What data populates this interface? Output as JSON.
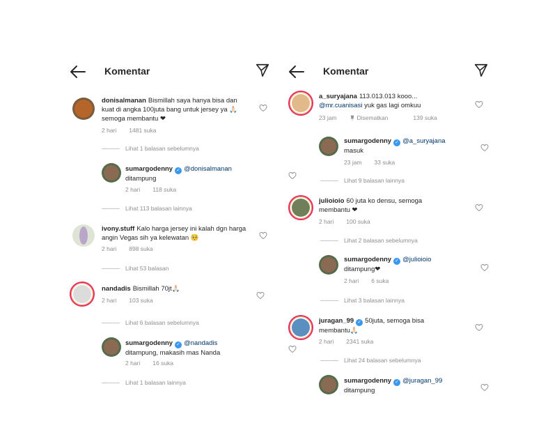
{
  "left": {
    "header": {
      "title": "Komentar"
    },
    "comments": [
      {
        "user": "donisalmanan",
        "text": "Bismillah saya hanya bisa dan kuat di angka 100juta bang untuk jersey ya 🙏🏻 semoga membantu ❤",
        "time": "2 hari",
        "likes": "1481 suka"
      },
      {
        "replies_link": "Lihat 1 balasan sebelumnya"
      },
      {
        "user": "sumargodenny",
        "mention": "@donisalmanan",
        "text": "ditampung",
        "time": "2 hari",
        "likes": "118 suka"
      },
      {
        "replies_link": "Lihat 113 balasan lainnya"
      },
      {
        "user": "ivony.stuff",
        "text": "Kalo harga jersey ini kalah dgn harga angin Vegas sih ya kelewatan 🥺",
        "time": "2 hari",
        "likes": "898 suka"
      },
      {
        "replies_link": "Lihat 53 balasan"
      },
      {
        "user": "nandadis",
        "text": "Bismillah 70jt🙏🏻",
        "time": "2 hari",
        "likes": "103 suka"
      },
      {
        "replies_link": "Lihat 6 balasan sebelumnya"
      },
      {
        "user": "sumargodenny",
        "mention": "@nandadis",
        "text": "ditampung, makasih mas Nanda",
        "time": "2 hari",
        "likes": "16 suka"
      },
      {
        "replies_link": "Lihat 1 balasan lainnya"
      }
    ]
  },
  "right": {
    "header": {
      "title": "Komentar"
    },
    "comments": [
      {
        "user": "a_suryajana",
        "text": "113.013.013 kooo... ",
        "mention": "@mr.cuanisasi",
        "text2": " yuk gas lagi omkuu",
        "time": "23 jam",
        "pinned": "Disematkan",
        "likes": "139 suka"
      },
      {
        "user": "sumargodenny",
        "mention": "@a_suryajana",
        "text": "masuk",
        "time": "23 jam",
        "likes": "33 suka"
      },
      {
        "replies_link": "Lihat 9 balasan lainnya"
      },
      {
        "user": "julioioio",
        "text": "60 juta ko densu, semoga membantu ❤",
        "time": "2 hari",
        "likes": "100 suka"
      },
      {
        "replies_link": "Lihat 2 balasan sebelumnya"
      },
      {
        "user": "sumargodenny",
        "mention": "@julioioio",
        "text": "ditampung❤",
        "time": "2 hari",
        "likes": "6 suka"
      },
      {
        "replies_link": "Lihat 3 balasan lainnya"
      },
      {
        "user": "juragan_99",
        "text": "50juta, semoga bisa membantu🙏🏻",
        "time": "2 hari",
        "likes": "2341 suka"
      },
      {
        "replies_link": "Lihat 24 balasan sebelumnya"
      },
      {
        "user": "sumargodenny",
        "mention": "@juragan_99",
        "text": "ditampung"
      }
    ]
  },
  "icons": {
    "back": "arrow-left-icon",
    "send": "paper-plane-icon",
    "heart": "heart-outline-icon",
    "verified": "verified-badge-icon",
    "pin": "pin-icon"
  },
  "colors": {
    "text": "#262626",
    "muted": "#8e8e8e",
    "mention": "#00376b",
    "verified": "#3897f0",
    "story_ring": "#e1306c"
  }
}
